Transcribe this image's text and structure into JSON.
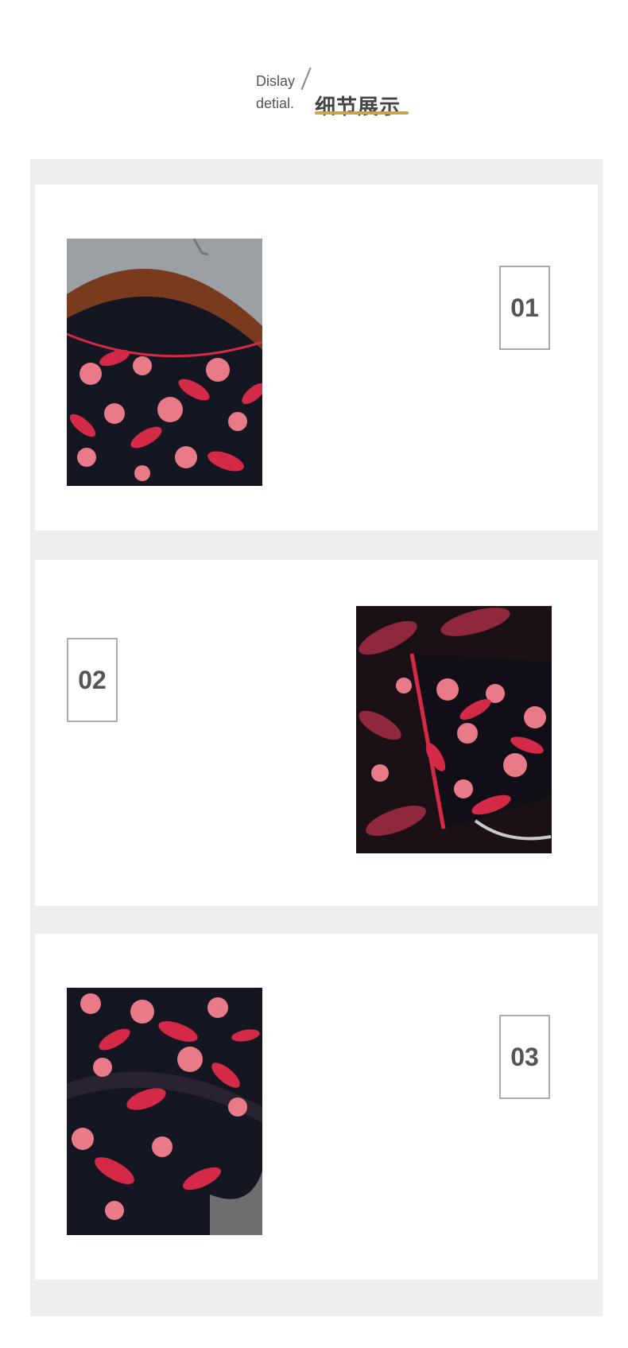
{
  "header": {
    "en_line1": "Dislay",
    "en_line2": "detial.",
    "cn_title": "细节展示"
  },
  "details": [
    {
      "number": "01",
      "image": "hanger-neckline-cherry-print"
    },
    {
      "number": "02",
      "image": "cuff-ruffle-cherry-print"
    },
    {
      "number": "03",
      "image": "draped-fabric-cherry-print"
    }
  ],
  "colors": {
    "frame": "#efefef",
    "accent_underline": "#c5a454",
    "fabric_base": "#141622",
    "print_red": "#d42a48",
    "print_pink": "#e97a88"
  }
}
